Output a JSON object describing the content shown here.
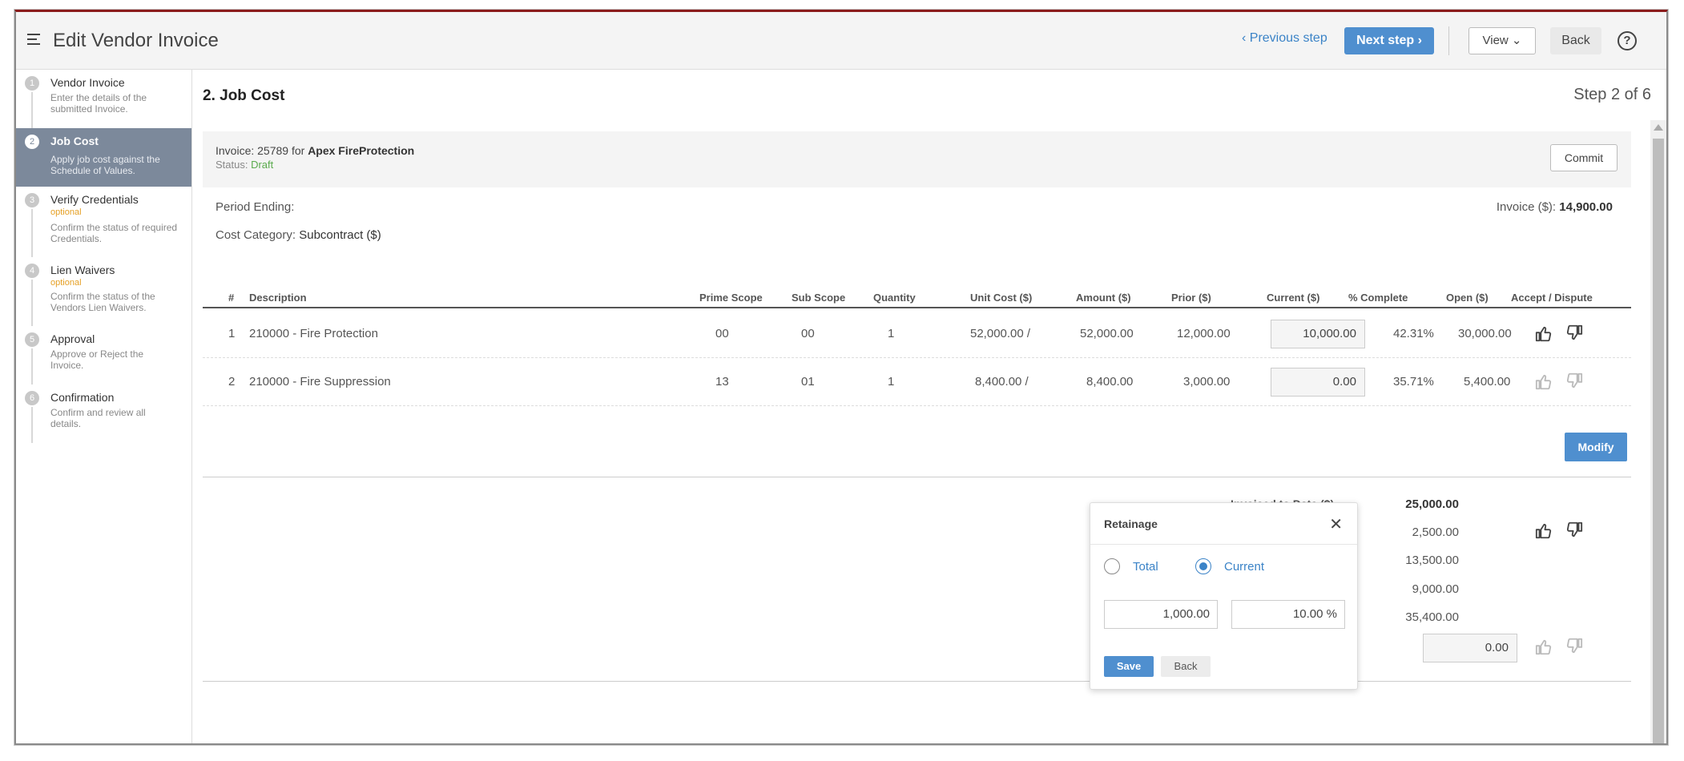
{
  "header": {
    "title": "Edit Vendor Invoice",
    "prev_label": "Previous step",
    "next_label": "Next step",
    "view_label": "View",
    "back_label": "Back",
    "help_glyph": "?"
  },
  "sidebar": {
    "steps": [
      {
        "num": "1",
        "title": "Vendor Invoice",
        "optional": "",
        "desc": "Enter the details of the submitted Invoice."
      },
      {
        "num": "2",
        "title": "Job Cost",
        "optional": "",
        "desc": "Apply job cost against the Schedule of Values."
      },
      {
        "num": "3",
        "title": "Verify Credentials",
        "optional": "optional",
        "desc": "Confirm the status of required Credentials."
      },
      {
        "num": "4",
        "title": "Lien Waivers",
        "optional": "optional",
        "desc": "Confirm the status of the Vendors Lien Waivers."
      },
      {
        "num": "5",
        "title": "Approval",
        "optional": "",
        "desc": "Approve or Reject the Invoice."
      },
      {
        "num": "6",
        "title": "Confirmation",
        "optional": "",
        "desc": "Confirm and review all details."
      }
    ]
  },
  "main": {
    "section_title": "2. Job Cost",
    "step_counter": "Step 2 of 6",
    "invoice_prefix": "Invoice: 25789 for ",
    "vendor": "Apex FireProtection",
    "status_prefix": "Status: ",
    "status": "Draft",
    "commit_label": "Commit",
    "period_ending": "Period Ending:",
    "cost_category_prefix": "Cost Category: ",
    "cost_category": "Subcontract ($)",
    "invoice_amount_prefix": "Invoice ($): ",
    "invoice_amount": "14,900.00",
    "modify_label": "Modify"
  },
  "table": {
    "headers": [
      "#",
      "Description",
      "Prime Scope",
      "Sub Scope",
      "Quantity",
      "Unit Cost ($)",
      "Amount ($)",
      "Prior ($)",
      "Current ($)",
      "% Complete",
      "Open ($)",
      "Accept / Dispute"
    ],
    "rows": [
      {
        "num": "1",
        "desc": "210000 - Fire Protection",
        "prime": "00",
        "sub": "00",
        "qty": "1",
        "unit": "52,000.00 /",
        "amount": "52,000.00",
        "prior": "12,000.00",
        "current": "10,000.00",
        "pct": "42.31%",
        "open": "30,000.00"
      },
      {
        "num": "2",
        "desc": "210000 - Fire Suppression",
        "prime": "13",
        "sub": "01",
        "qty": "1",
        "unit": "8,400.00 /",
        "amount": "8,400.00",
        "prior": "3,000.00",
        "current": "0.00",
        "pct": "35.71%",
        "open": "5,400.00"
      }
    ]
  },
  "summary": {
    "invoiced_label": "Invoiced to Date ($):",
    "invoiced_value": "25,000.00",
    "v2": "2,500.00",
    "v3": "13,500.00",
    "v4": "9,000.00",
    "v5": "35,400.00",
    "input_value": "0.00"
  },
  "retainage": {
    "title": "Retainage",
    "close_glyph": "✕",
    "option_total": "Total",
    "option_current": "Current",
    "selected": "Current",
    "amount": "1,000.00",
    "percent": "10.00 %",
    "save_label": "Save",
    "back_label": "Back"
  },
  "colors": {
    "accent": "#4f8fcf",
    "link": "#3b83c7",
    "active_step": "#7c899b",
    "draft": "#5aaa4d",
    "optional": "#e5a025"
  }
}
